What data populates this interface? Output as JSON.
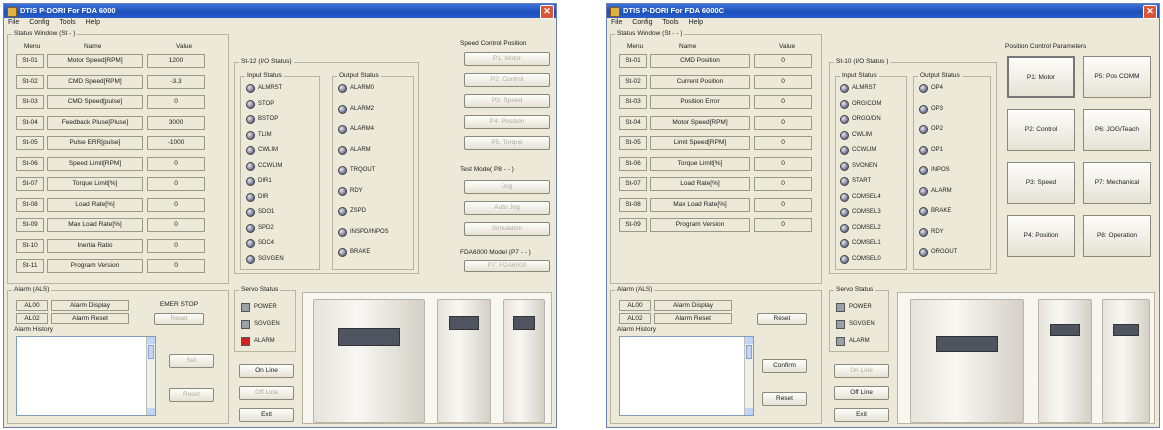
{
  "left": {
    "title": "DTIS P-DORI For FDA 6000",
    "menu": [
      "File",
      "Config",
      "Tools",
      "Help"
    ],
    "status_group": "Status Window (St - )",
    "col_menu": "Menu",
    "col_name": "Name",
    "col_value": "Value",
    "rows": [
      {
        "menu": "St-01",
        "name": "Motor Speed[RPM]",
        "value": "1200"
      },
      {
        "menu": "St-02",
        "name": "CMD Speed[RPM]",
        "value": "-3.3"
      },
      {
        "menu": "St-03",
        "name": "CMD Speed[pulse]",
        "value": "0"
      },
      {
        "menu": "St-04",
        "name": "Feedback Pluse[Pluse]",
        "value": "3000"
      },
      {
        "menu": "St-05",
        "name": "Pulse ERR[pulse]",
        "value": "-1000"
      },
      {
        "menu": "St-06",
        "name": "Speed Limit[RPM]",
        "value": "0"
      },
      {
        "menu": "St-07",
        "name": "Torque Limit[%]",
        "value": "0"
      },
      {
        "menu": "St-08",
        "name": "Load Rate[%]",
        "value": "0"
      },
      {
        "menu": "St-09",
        "name": "Max Load Rate[%]",
        "value": "0"
      },
      {
        "menu": "St-10",
        "name": "Inertia Ratio",
        "value": "0"
      },
      {
        "menu": "St-11",
        "name": "Program Version",
        "value": "0"
      }
    ],
    "io_group": "St-12 (I/O Status)",
    "input_label": "Input Status",
    "output_label": "Output Status",
    "inputs": [
      "ALMRST",
      "STOP",
      "BSTOP",
      "TLIM",
      "CWLIM",
      "CCWLIM",
      "DIR1",
      "DIR",
      "SDO1",
      "SPD2",
      "SDC4",
      "SGVGEN"
    ],
    "outputs": [
      "ALARM0",
      "ALARM2",
      "ALARM4",
      "ALARM",
      "TRQOUT",
      "RDY",
      "ZSPD",
      "INSPD/INPOS",
      "BRAKE"
    ],
    "speed_group": "Speed Control Position",
    "speed_buttons": [
      "P1: Motor",
      "P2: Control",
      "P3: Speed",
      "P4: Position",
      "P5: Torque"
    ],
    "test_group": "Test Mode( P8 - - )",
    "test_buttons": [
      "Jog",
      "Auto Jog",
      "Simulation"
    ],
    "fdamode_group": "FDA6000 Model (P7 - - )",
    "fdamode_button": "P7: FDA6000",
    "alarm_group": "Alarm (ALS)",
    "alarm_rows": [
      {
        "code": "AL00",
        "name": "Alarm Display",
        "value": "EMER STOP"
      },
      {
        "code": "AL02",
        "name": "Alarm Reset",
        "value": "Reset"
      }
    ],
    "alarm_history": "Alarm History",
    "alarm_buttons": [
      "Set",
      "Reset"
    ],
    "servo_group": "Servo Status",
    "servo_items": [
      "POWER",
      "SGVGEN",
      "ALARM"
    ],
    "side_buttons": [
      "On Line",
      "Off Line",
      "Exit"
    ]
  },
  "right": {
    "title": "DTIS P-DORI For FDA 6000C",
    "menu": [
      "File",
      "Config",
      "Tools",
      "Help"
    ],
    "status_group": "Status Window (St - - )",
    "col_menu": "Menu",
    "col_name": "Name",
    "col_value": "Value",
    "rows": [
      {
        "menu": "St-01",
        "name": "CMD Position",
        "value": "0"
      },
      {
        "menu": "St-02",
        "name": "Current Position",
        "value": "0"
      },
      {
        "menu": "St-03",
        "name": "Position Error",
        "value": "0"
      },
      {
        "menu": "St-04",
        "name": "Motor Speed[RPM]",
        "value": "0"
      },
      {
        "menu": "St-05",
        "name": "Limit Speed[RPM]",
        "value": "0"
      },
      {
        "menu": "St-06",
        "name": "Torque Limit[%]",
        "value": "0"
      },
      {
        "menu": "St-07",
        "name": "Load Rate[%]",
        "value": "0"
      },
      {
        "menu": "St-08",
        "name": "Max Load Rate[%]",
        "value": "0"
      },
      {
        "menu": "St-09",
        "name": "Program Version",
        "value": "0"
      }
    ],
    "io_group": "St-10 (I/O Status )",
    "input_label": "Input Status",
    "output_label": "Output Status",
    "inputs": [
      "ALMRST",
      "ORG/COM",
      "ORGO/DN",
      "CWLIM",
      "CCWLIM",
      "SVONEN",
      "START",
      "COMSEL4",
      "COMSEL3",
      "COMSEL2",
      "COMSEL1",
      "COMSEL0"
    ],
    "outputs": [
      "OP4",
      "OP3",
      "OP2",
      "OP1",
      "INPOS",
      "ALARM",
      "BRAKE",
      "RDY",
      "ORGOUT"
    ],
    "param_group": "Position Control Parameters",
    "param_buttons": [
      "P1: Motor",
      "P5: Pos COMM",
      "P2: Control",
      "P6: JOG/Teach",
      "P3: Speed",
      "P7: Mechanical",
      "P4: Position",
      "P8: Operation"
    ],
    "alarm_group": "Alarm (ALS)",
    "alarm_rows": [
      {
        "code": "AL00",
        "name": "Alarm Display",
        "value": ""
      },
      {
        "code": "AL02",
        "name": "Alarm Reset",
        "value": "Reset"
      }
    ],
    "alarm_history": "Alarm History",
    "alarm_buttons": [
      "Confirm",
      "Reset"
    ],
    "servo_group": "Servo Status",
    "servo_items": [
      "POWER",
      "SGVGEN",
      "ALARM"
    ],
    "side_buttons": [
      "On Line",
      "Off Line",
      "Exit"
    ]
  }
}
